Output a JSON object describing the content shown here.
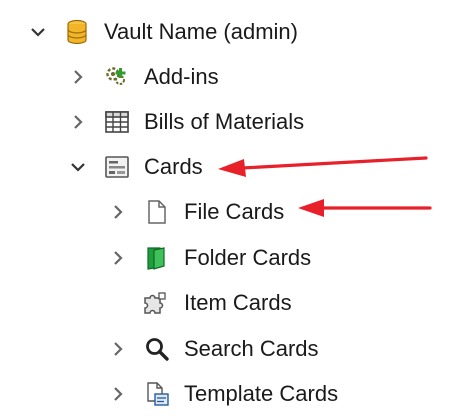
{
  "tree": {
    "root": {
      "label": "Vault Name (admin)",
      "icon": "vault-database-icon",
      "expanded": true
    },
    "items": [
      {
        "label": "Add-ins",
        "icon": "add-ins-icon",
        "expanded": false
      },
      {
        "label": "Bills of Materials",
        "icon": "table-icon",
        "expanded": false
      },
      {
        "label": "Cards",
        "icon": "card-icon",
        "expanded": true,
        "children": [
          {
            "label": "File Cards",
            "icon": "file-icon",
            "expanded": false
          },
          {
            "label": "Folder Cards",
            "icon": "folder-icon",
            "expanded": false
          },
          {
            "label": "Item Cards",
            "icon": "item-puzzle-icon"
          },
          {
            "label": "Search Cards",
            "icon": "search-icon",
            "expanded": false
          },
          {
            "label": "Template Cards",
            "icon": "template-icon",
            "expanded": false
          }
        ]
      }
    ]
  },
  "annotations": {
    "arrow_color": "#e8202a"
  }
}
